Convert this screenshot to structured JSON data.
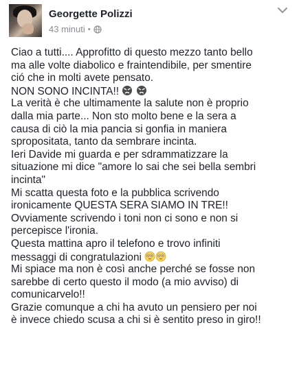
{
  "post": {
    "author": "Georgette Polizzi",
    "time": "43 minuti",
    "separator": "•",
    "lines": [
      "Ciao a tutti.... Approfitto di questo mezzo tanto bello",
      "ma alle volte diabolico e fraintendibile, per smentire",
      "ció che in molti avete pensato.",
      "NON SONO INCINTA!!",
      "La verità è che ultimamente la salute non è proprio",
      "dalla mia parte... Non sto molto bene e la sera a",
      "causa di ciò la mia pancia si gonfia in maniera",
      "spropositata, tanto da sembrare incinta.",
      "Ieri Davide mi guarda e per sdrammatizzare la",
      "situazione mi dice \"amore lo sai che sei bella sembri",
      "incinta\"",
      "Mi scatta questa foto e la pubblica scrivendo",
      "ironicamente QUESTA SERA SIAMO IN TRE!!",
      "Ovviamente scrivendo i toni non ci sono e non si",
      "percepisce l'ironia.",
      "Questa mattina apro il telefono e trovo infiniti",
      "messaggi di congratulazioni",
      "Mi spiace ma non è così anche perché se fosse non",
      "sarebbe di certo questo il modo (a mio avviso) di",
      "comunicarvelo!!",
      "Grazie comunque a chi ha avuto un pensiero per noi",
      "è invece chiedo scusa a chi si è sentito preso in giro!!"
    ]
  },
  "icons": {
    "globe": "globe-icon",
    "chevron": "chevron-down-icon",
    "emoji_angry": "angry-face-emoji",
    "emoji_flushed": "flushed-face-emoji"
  }
}
